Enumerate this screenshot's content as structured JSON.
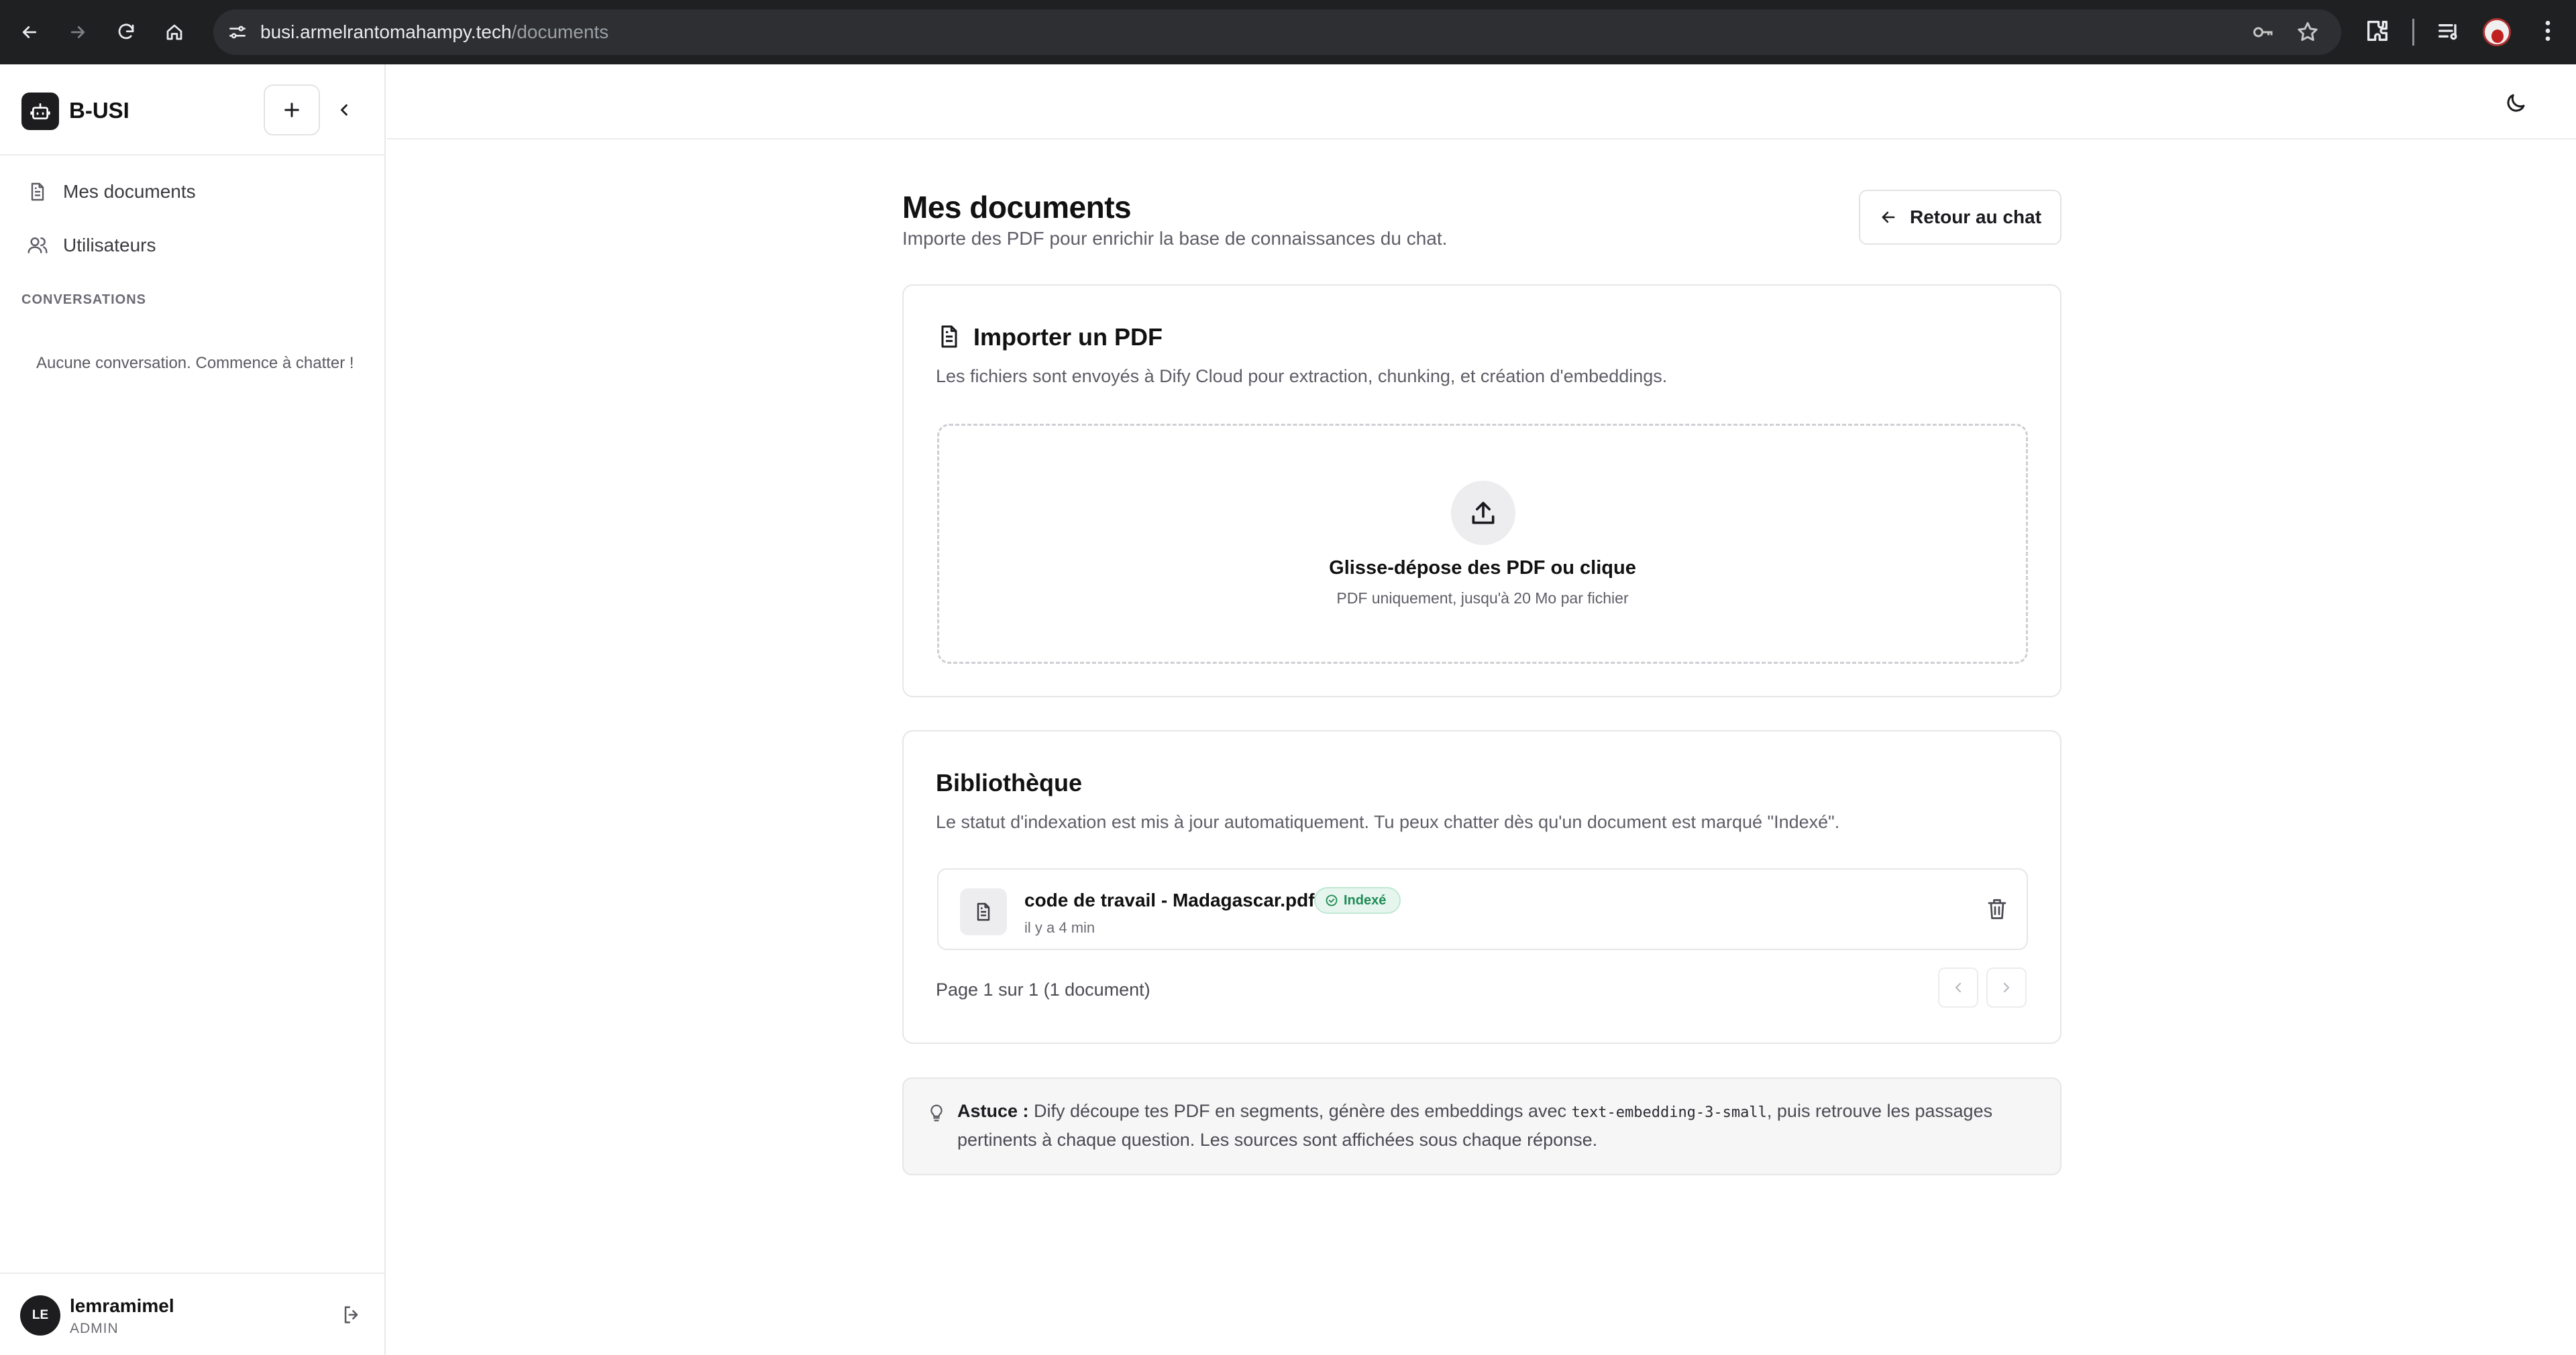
{
  "browser": {
    "url_host": "busi.armelrantomahampy.tech",
    "url_path": "/documents"
  },
  "sidebar": {
    "brand": "B-USI",
    "nav": [
      {
        "label": "Mes documents",
        "icon": "file-text-icon"
      },
      {
        "label": "Utilisateurs",
        "icon": "users-icon"
      }
    ],
    "section_label": "CONVERSATIONS",
    "empty_text": "Aucune conversation. Commence à chatter !",
    "user": {
      "initials": "LE",
      "name": "lemramimel",
      "role": "ADMIN"
    }
  },
  "page": {
    "title": "Mes documents",
    "subtitle": "Importe des PDF pour enrichir la base de connaissances du chat.",
    "back_label": "Retour au chat"
  },
  "import_card": {
    "title": "Importer un PDF",
    "description": "Les fichiers sont envoyés à Dify Cloud pour extraction, chunking, et création d'embeddings.",
    "dropzone_title": "Glisse-dépose des PDF ou clique",
    "dropzone_sub": "PDF uniquement, jusqu'à 20 Mo par fichier"
  },
  "library_card": {
    "title": "Bibliothèque",
    "description": "Le statut d'indexation est mis à jour automatiquement. Tu peux chatter dès qu'un document est marqué \"Indexé\".",
    "files": [
      {
        "name": "code de travail - Madagascar.pdf",
        "status": "Indexé",
        "time": "il y a 4 min"
      }
    ],
    "pager": "Page 1 sur 1 (1 document)"
  },
  "tip": {
    "label": "Astuce :",
    "text_before": " Dify découpe tes PDF en segments, génère des embeddings avec ",
    "code": "text-embedding-3-small",
    "text_after": ", puis retrouve les passages pertinents à chaque question. Les sources sont affichées sous chaque réponse."
  },
  "colors": {
    "accent": "#1d1d20",
    "success": "#1f8a55",
    "success_bg": "#e6f6ee"
  }
}
